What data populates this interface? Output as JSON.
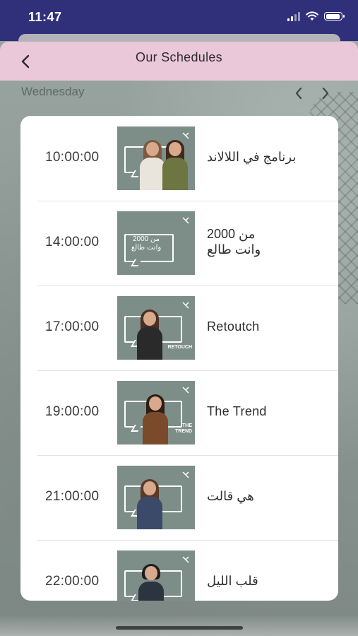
{
  "status_bar": {
    "time": "11:47"
  },
  "nav": {
    "title": "Our Schedules",
    "back_icon": "chevron-left-icon"
  },
  "day_selector": {
    "day": "Wednesday",
    "prev_icon": "chevron-left-icon",
    "next_icon": "chevron-right-icon"
  },
  "colors": {
    "status_bar": "#30307a",
    "nav_bar": "#eac8d9",
    "card": "#ffffff",
    "thumb_bg": "#7d8e88"
  },
  "schedule": [
    {
      "time": "10:00:00",
      "name": "برنامج في اللالاند"
    },
    {
      "time": "14:00:00",
      "name_line1": "من 2000",
      "name_line2": "وانت طالع",
      "thumb_text": "من 2000 وانت طالع"
    },
    {
      "time": "17:00:00",
      "name": "Retoutch",
      "thumb_word": "RETOUCH"
    },
    {
      "time": "19:00:00",
      "name": "The Trend",
      "thumb_word": "THE TREND"
    },
    {
      "time": "21:00:00",
      "name": "هي قالت"
    },
    {
      "time": "22:00:00",
      "name": "قلب الليل"
    }
  ]
}
